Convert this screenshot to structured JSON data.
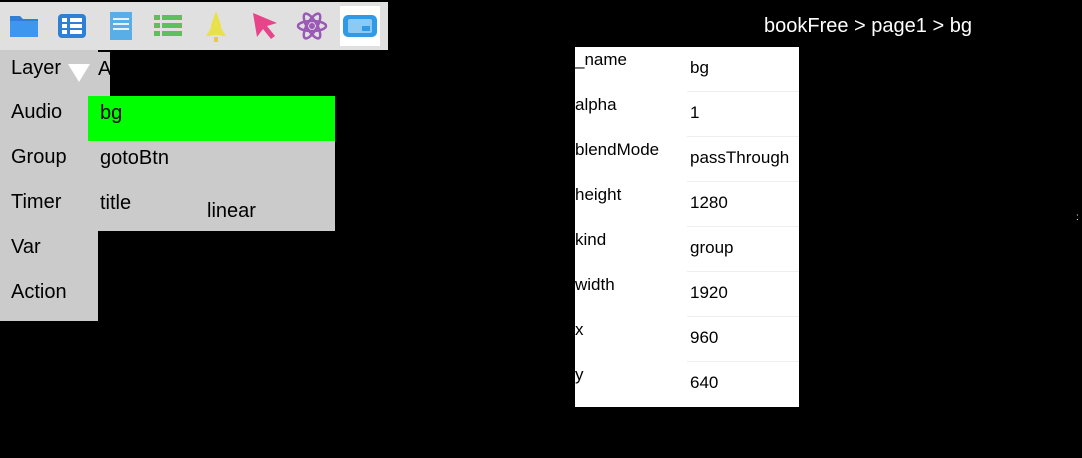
{
  "toolbar": {
    "buttons": [
      {
        "name": "folder-icon",
        "color": "#2f7fd6"
      },
      {
        "name": "list-icon",
        "color": "#2f7fd6"
      },
      {
        "name": "page-icon",
        "color": "#5aaee8"
      },
      {
        "name": "table-icon",
        "color": "#5fbf5f"
      },
      {
        "name": "rocket-icon",
        "color": "#e8e14a"
      },
      {
        "name": "cursor-icon",
        "color": "#e8448a"
      },
      {
        "name": "atom-icon",
        "color": "#9b59b6"
      },
      {
        "name": "device-icon",
        "color": "#2f9be8"
      }
    ]
  },
  "side_menu": {
    "items": [
      "Layer",
      "Audio",
      "Group",
      "Timer",
      "Var",
      "Action"
    ],
    "cap_text": "A"
  },
  "layer_list": {
    "items": [
      {
        "label": "bg",
        "active": true
      },
      {
        "label": "gotoBtn",
        "active": false
      },
      {
        "label": "title",
        "active": false
      }
    ],
    "note": "linear",
    "active_color": "#00ff00"
  },
  "breadcrumb": "bookFree > page1 > bg",
  "properties": [
    {
      "key": "_name",
      "value": "bg"
    },
    {
      "key": "alpha",
      "value": "1"
    },
    {
      "key": "blendMode",
      "value": "passThrough"
    },
    {
      "key": "height",
      "value": "1280"
    },
    {
      "key": "kind",
      "value": "group"
    },
    {
      "key": "width",
      "value": "1920"
    },
    {
      "key": "x",
      "value": "960"
    },
    {
      "key": "y",
      "value": "640"
    }
  ]
}
